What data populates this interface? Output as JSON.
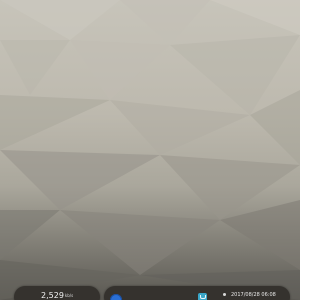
{
  "desktop": {
    "wallpaper": {
      "style": "low-poly gradient",
      "colors": {
        "top": "#c7c4ba",
        "middle": "#aaa79c",
        "bottom": "#5a5852"
      }
    },
    "network_widget": {
      "value": "2,529",
      "unit": "kb/s",
      "background": "#35322e"
    },
    "taskbar": {
      "launcher_icon": "launcher-icon",
      "app_icon": "app-icon",
      "tray_icon": "dot-icon",
      "clock": "2017/08/28 06:08",
      "accent": "#2a6fd6",
      "app_color": "#39a6c8",
      "background": "#35322e"
    }
  }
}
